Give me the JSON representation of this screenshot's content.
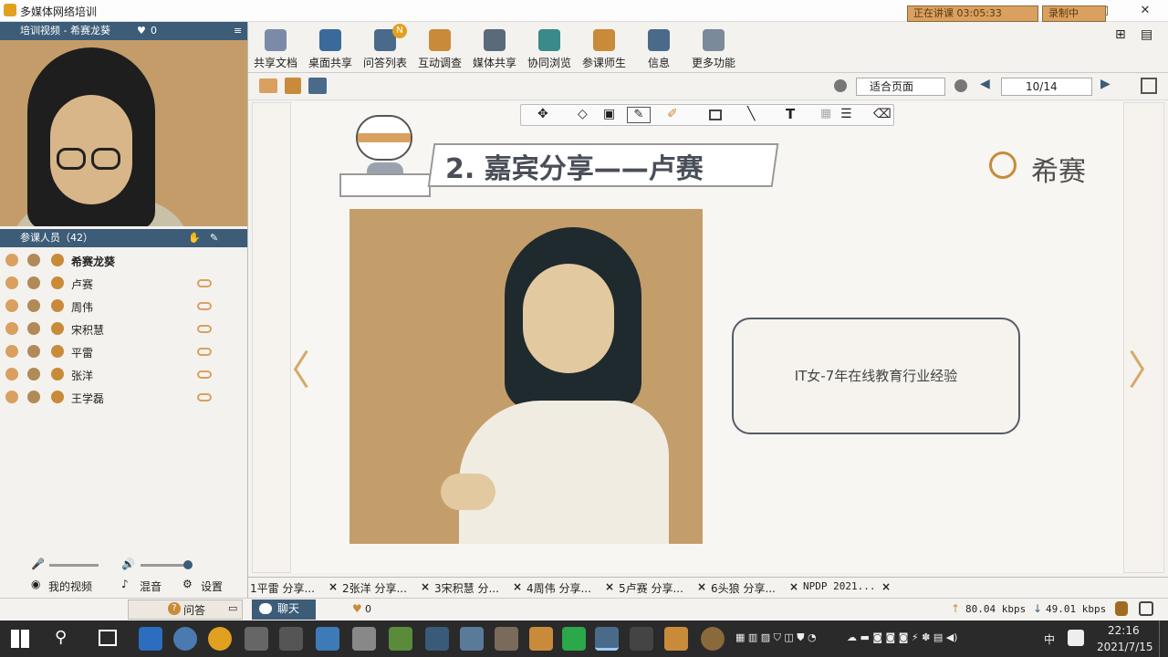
{
  "window": {
    "title": "多媒体网络培训",
    "controls": [
      "—",
      "□",
      "✕"
    ]
  },
  "left_panel": {
    "video_header": "培训视频 - 希赛龙葵",
    "video_likes": "0",
    "participants_header": "参课人员（42）",
    "participants": [
      {
        "name": "希赛龙葵",
        "bold": true,
        "chat": false
      },
      {
        "name": "卢赛",
        "bold": false,
        "chat": true
      },
      {
        "name": "周伟",
        "bold": false,
        "chat": true
      },
      {
        "name": "宋积慧",
        "bold": false,
        "chat": true
      },
      {
        "name": "平雷",
        "bold": false,
        "chat": true
      },
      {
        "name": "张洋",
        "bold": false,
        "chat": true
      },
      {
        "name": "王学磊",
        "bold": false,
        "chat": true
      }
    ],
    "controls": {
      "my_video": "我的视频",
      "mix": "混音",
      "settings": "设置"
    }
  },
  "toolbar": {
    "buttons": [
      "共享文档",
      "桌面共享",
      "问答列表",
      "互动调查",
      "媒体共享",
      "协同浏览",
      "参课师生",
      "信息",
      "更多功能"
    ],
    "badge": "N",
    "status_left": "正在讲课 03:05:33",
    "status_right": "录制中"
  },
  "view": {
    "zoom": "适合页面",
    "page": "10/14"
  },
  "slide": {
    "title": "2. 嘉宾分享——卢赛",
    "brand": "希赛",
    "info": "IT女-7年在线教育行业经验"
  },
  "tabs": [
    "1平雷 分享...",
    "2张洋 分享...",
    "3宋积慧 分...",
    "4周伟 分享...",
    "5卢赛 分享...",
    "6头狼 分享...",
    "NPDP 2021..."
  ],
  "bottom_bar": {
    "qa": "问答",
    "chat": "聊天",
    "likes": "0",
    "upload": "80.04 kbps",
    "download": "49.01 kbps"
  },
  "taskbar": {
    "time": "22:16",
    "date": "2021/7/15",
    "ime": "中"
  },
  "colors": {
    "accent": "#d9a060",
    "header": "#3c5c78",
    "photo_bg": "#c49e6a"
  }
}
